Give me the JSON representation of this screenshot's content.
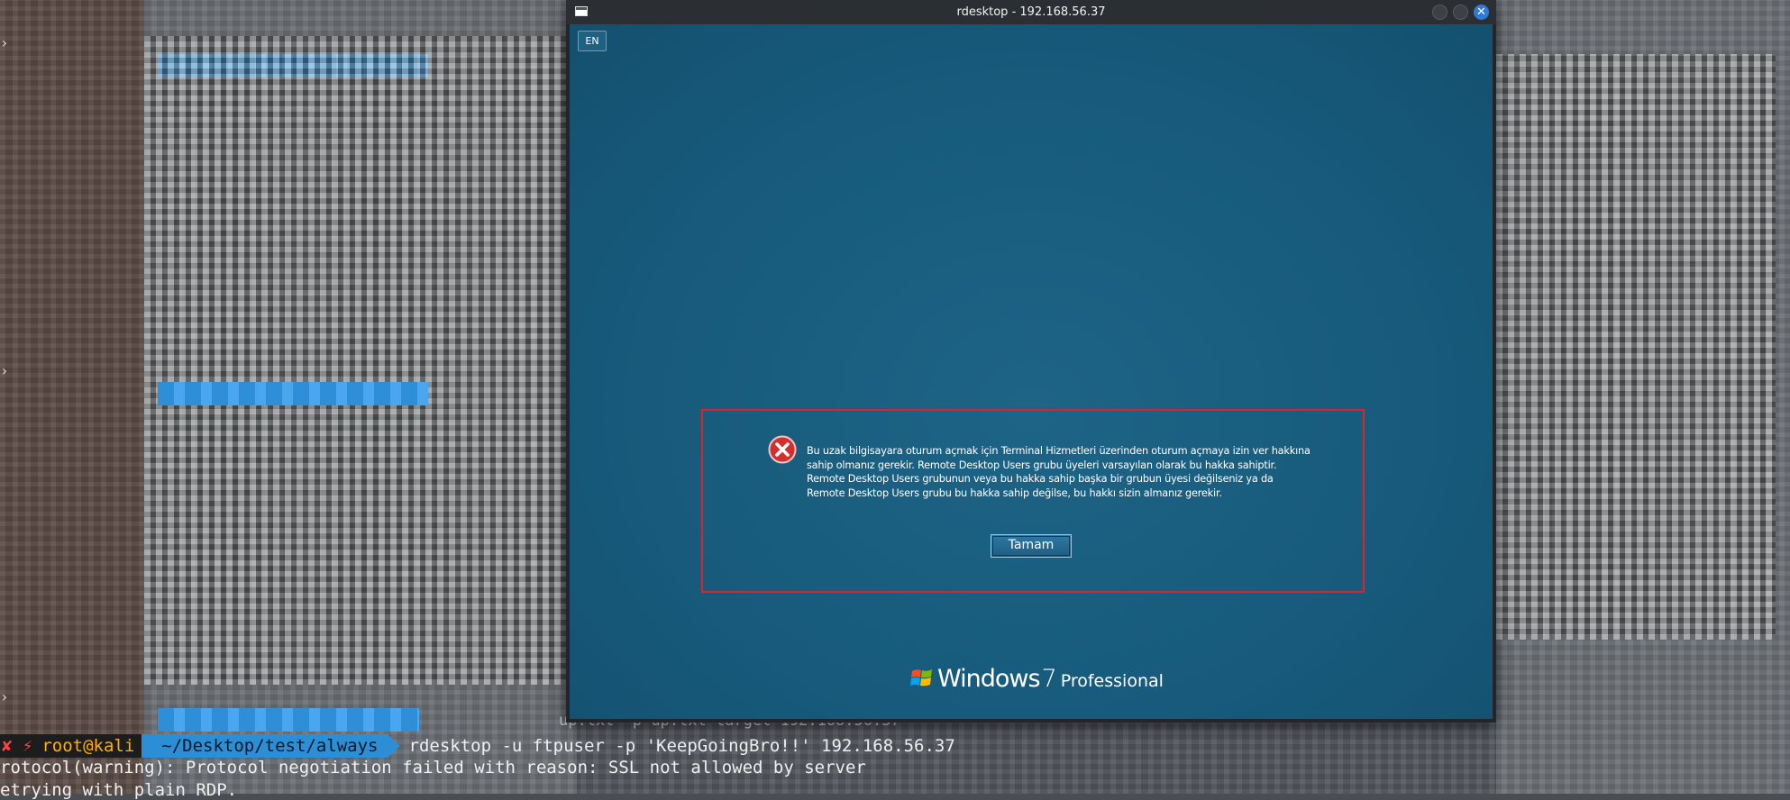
{
  "terminal": {
    "prompt": {
      "status_glyph": "✘ ⚡",
      "user_host": "root@kali",
      "path": "~/Desktop/test/always",
      "command": "rdesktop -u ftpuser -p 'KeepGoingBro!!' 192.168.56.37"
    },
    "hidden_prev_command": "up.txt -p up.txt target 192.168.56.37",
    "output": [
      "rotocol(warning): Protocol negotiation failed with reason: SSL not allowed by server",
      "etrying with plain RDP."
    ]
  },
  "window": {
    "title": "rdesktop - 192.168.56.37",
    "close_glyph": "✕"
  },
  "remote": {
    "language_button": "EN",
    "error_message": "Bu uzak bilgisayara oturum açmak için Terminal Hizmetleri üzerinden oturum açmaya izin ver hakkına sahip olmanız gerekir. Remote Desktop Users grubu üyeleri varsayılan olarak bu hakka sahiptir. Remote Desktop Users grubunun veya bu hakka sahip başka bir grubun üyesi değilseniz ya da Remote Desktop Users grubu bu hakka sahip değilse, bu hakkı sizin almanız gerekir.",
    "ok_button": "Tamam",
    "logo": {
      "brand": "Windows",
      "version": "7",
      "edition": "Professional"
    },
    "colors": {
      "background": "#195b7b",
      "highlight_border": "#e0202a",
      "error_icon": "#d32f2f"
    }
  }
}
